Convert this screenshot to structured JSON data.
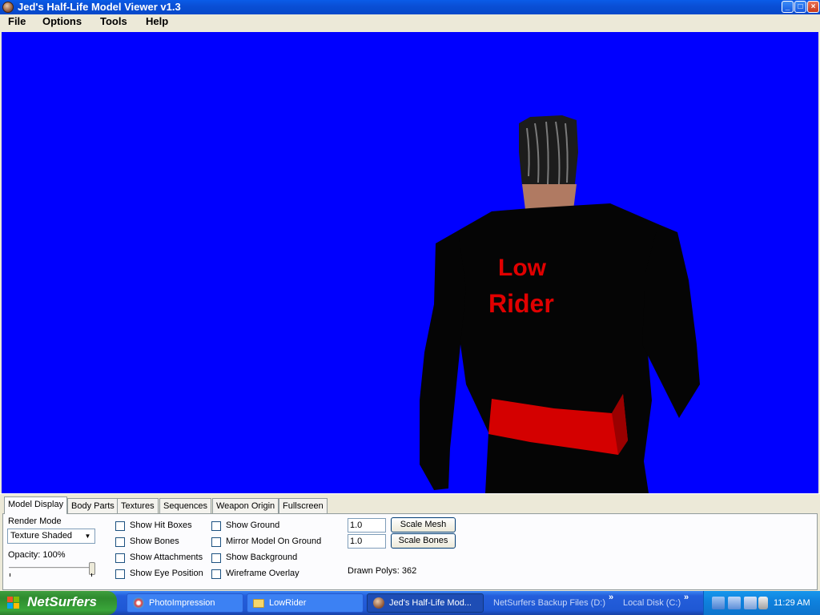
{
  "window": {
    "title": "Jed's Half-Life Model Viewer v1.3",
    "controls": {
      "minimize": "_",
      "maximize": "□",
      "close": "×"
    }
  },
  "menu": [
    "File",
    "Options",
    "Tools",
    "Help"
  ],
  "viewport": {
    "background": "#0000ff",
    "jacket_text_line1": "Low",
    "jacket_text_line2": "Rider",
    "accent": "#e00000"
  },
  "tabs": [
    "Model Display",
    "Body Parts",
    "Textures",
    "Sequences",
    "Weapon Origin",
    "Fullscreen"
  ],
  "model_display": {
    "render_mode_label": "Render Mode",
    "render_mode_value": "Texture Shaded",
    "opacity_label": "Opacity: 100%",
    "opacity_value": 100,
    "checkboxes_col1": [
      "Show Hit Boxes",
      "Show Bones",
      "Show Attachments",
      "Show Eye Position"
    ],
    "checkboxes_col2": [
      "Show Ground",
      "Mirror Model On Ground",
      "Show Background",
      "Wireframe Overlay"
    ],
    "scale_mesh_value": "1.0",
    "scale_mesh_button": "Scale Mesh",
    "scale_bones_value": "1.0",
    "scale_bones_button": "Scale Bones",
    "drawn_polys": "Drawn Polys: 362"
  },
  "taskbar": {
    "start_label": "NetSurfers",
    "buttons": [
      "PhotoImpression",
      "LowRider",
      "Jed's Half-Life Mod..."
    ],
    "quick_items": [
      "NetSurfers Backup Files (D:)",
      "Local Disk (C:)"
    ],
    "chevron": "»",
    "clock": "11:29 AM"
  },
  "icons": [
    "app-icon",
    "windows-flag-icon",
    "photoimpression-icon",
    "folder-icon",
    "model-viewer-icon",
    "network-icon",
    "volume-icon"
  ]
}
